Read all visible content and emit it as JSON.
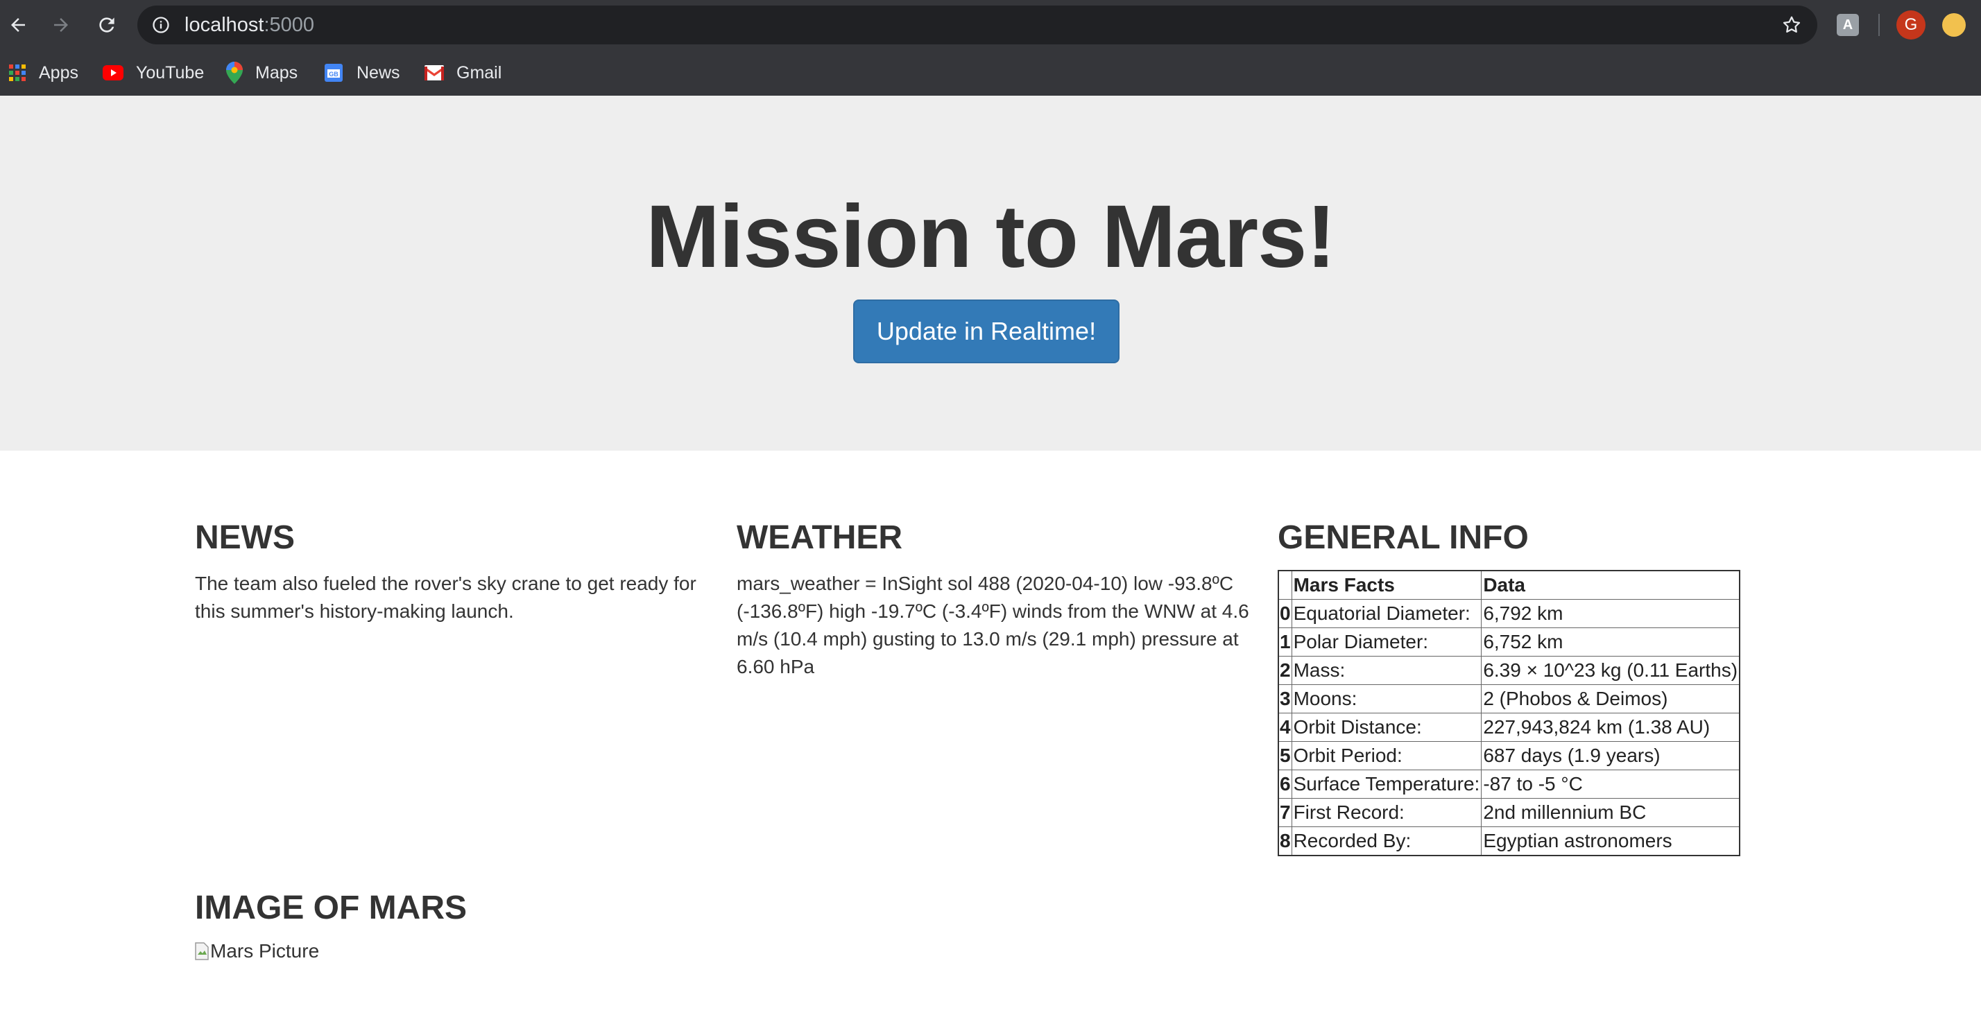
{
  "browser": {
    "url_host": "localhost",
    "url_port": ":5000",
    "avatar_letter": "G",
    "bookmarks": [
      {
        "label": "Apps",
        "icon": "apps-grid-icon"
      },
      {
        "label": "YouTube",
        "icon": "youtube-icon"
      },
      {
        "label": "Maps",
        "icon": "maps-pin-icon"
      },
      {
        "label": "News",
        "icon": "news-icon"
      },
      {
        "label": "Gmail",
        "icon": "gmail-icon"
      }
    ],
    "colors": {
      "toolbar": "#35363a",
      "omnibox": "#202124"
    }
  },
  "page": {
    "title": "Mission to Mars!",
    "update_button": "Update in Realtime!",
    "accent_color": "#337ab7",
    "news": {
      "heading": "NEWS",
      "text": "The team also fueled the rover's sky crane to get ready for this summer's history-making launch."
    },
    "weather": {
      "heading": "WEATHER",
      "text": "mars_weather = InSight sol 488 (2020-04-10) low -93.8ºC (-136.8ºF) high -19.7ºC (-3.4ºF) winds from the WNW at 4.6 m/s (10.4 mph) gusting to 13.0 m/s (29.1 mph) pressure at 6.60 hPa"
    },
    "general_info": {
      "heading": "GENERAL INFO",
      "columns": [
        "Mars Facts",
        "Data"
      ],
      "rows": [
        {
          "index": "0",
          "fact": "Equatorial Diameter:",
          "data": "6,792 km"
        },
        {
          "index": "1",
          "fact": "Polar Diameter:",
          "data": "6,752 km"
        },
        {
          "index": "2",
          "fact": "Mass:",
          "data": "6.39 × 10^23 kg (0.11 Earths)"
        },
        {
          "index": "3",
          "fact": "Moons:",
          "data": "2 (Phobos & Deimos)"
        },
        {
          "index": "4",
          "fact": "Orbit Distance:",
          "data": "227,943,824 km (1.38 AU)"
        },
        {
          "index": "5",
          "fact": "Orbit Period:",
          "data": "687 days (1.9 years)"
        },
        {
          "index": "6",
          "fact": "Surface Temperature:",
          "data": "-87 to -5 °C"
        },
        {
          "index": "7",
          "fact": "First Record:",
          "data": "2nd millennium BC"
        },
        {
          "index": "8",
          "fact": "Recorded By:",
          "data": "Egyptian astronomers"
        }
      ]
    },
    "image": {
      "heading": "IMAGE OF MARS",
      "alt": "Mars Picture"
    }
  }
}
